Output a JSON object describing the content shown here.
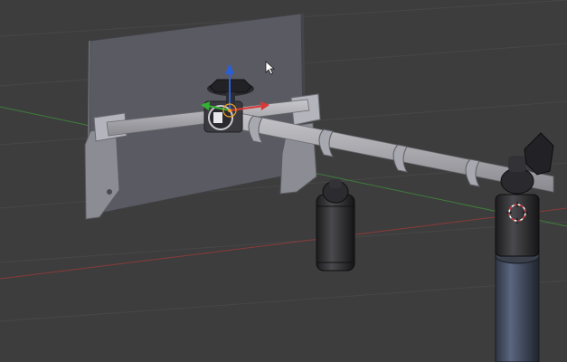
{
  "viewport": {
    "background_color": "#3d3d3d",
    "grid_color": "#474747",
    "x_axis_color": "#8a3a3a",
    "y_axis_color": "#3f7d3a",
    "objects": [
      "backboard-panel",
      "mounting-bracket",
      "horizontal-rail",
      "rail-clamps",
      "hanging-bulb-socket",
      "vertical-pole",
      "pole-socket",
      "side-knob",
      "top-knob"
    ],
    "gizmo": {
      "axis_z_color": "#2a5fd8",
      "axis_x_color": "#d83a3a",
      "axis_y_color": "#35b035",
      "pivot_color": "#f0a020"
    },
    "cursor_3d": "3d-cursor-icon",
    "mouse_pointer": "mouse-pointer-icon"
  }
}
